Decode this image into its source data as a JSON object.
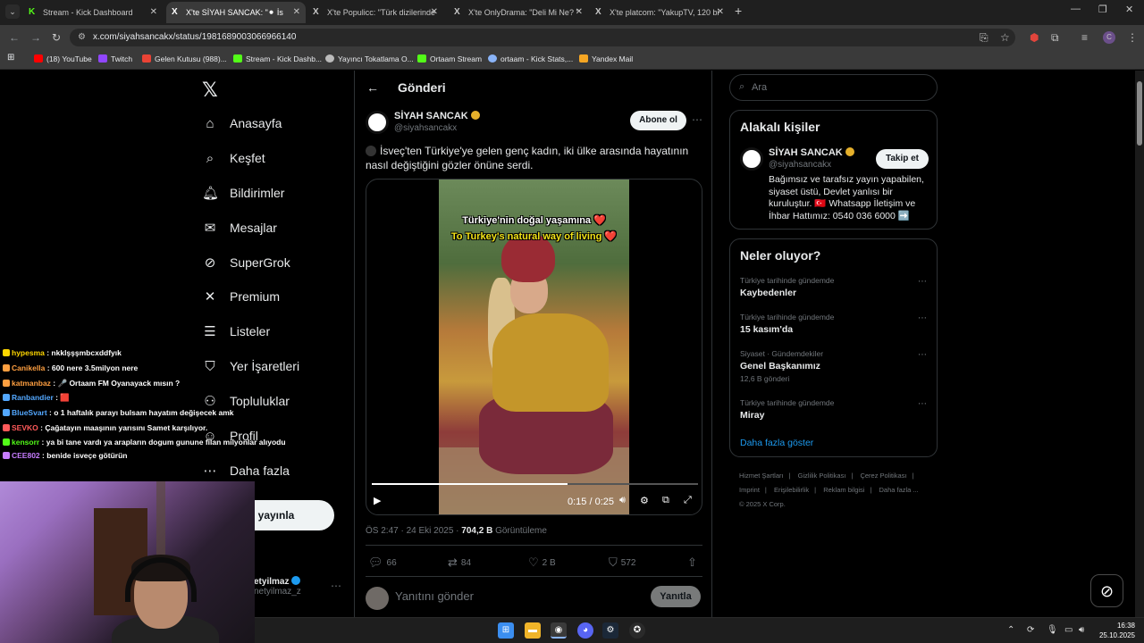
{
  "browser": {
    "tabs": [
      {
        "label": "Stream - Kick Dashboard",
        "icon": "kick-icon"
      },
      {
        "label": "X'te SİYAH SANCAK: \"⚫ İs",
        "icon": "x-icon",
        "active": true
      },
      {
        "label": "X'te Populicc: \"Türk dizilerinde",
        "icon": "x-icon"
      },
      {
        "label": "X'te OnlyDrama: \"Deli Mi Ne? \"",
        "icon": "x-icon"
      },
      {
        "label": "X'te platcom: \"YakupTV, 120 bi",
        "icon": "x-icon"
      }
    ],
    "url": "x.com/siyahsancakx/status/1981689003066966140",
    "bookmarks": [
      {
        "label": "(18) YouTube",
        "color": "#ff0000"
      },
      {
        "label": "Twitch",
        "color": "#9146ff"
      },
      {
        "label": "Gelen Kutusu (988)...",
        "color": "#ea4335"
      },
      {
        "label": "Stream - Kick Dashb...",
        "color": "#53fc18"
      },
      {
        "label": "Yayıncı Tokatlama O...",
        "color": "#bbbbbb"
      },
      {
        "label": "Ortaam Stream",
        "color": "#53fc18"
      },
      {
        "label": "ortaam - Kick Stats,...",
        "color": "#8ab4f8"
      },
      {
        "label": "Yandex Mail",
        "color": "#f5a623"
      }
    ]
  },
  "sidebar": {
    "items": [
      {
        "label": "Anasayfa",
        "icon": "home-icon"
      },
      {
        "label": "Keşfet",
        "icon": "search-icon"
      },
      {
        "label": "Bildirimler",
        "icon": "bell-icon"
      },
      {
        "label": "Mesajlar",
        "icon": "mail-icon"
      },
      {
        "label": "SuperGrok",
        "icon": "grok-icon"
      },
      {
        "label": "Premium",
        "icon": "x-icon"
      },
      {
        "label": "Listeler",
        "icon": "list-icon"
      },
      {
        "label": "Yer İşaretleri",
        "icon": "bookmark-icon"
      },
      {
        "label": "Topluluklar",
        "icon": "communities-icon"
      },
      {
        "label": "Profil",
        "icon": "profile-icon"
      },
      {
        "label": "Daha fazla",
        "icon": "more-icon"
      }
    ],
    "post_button": "eri yayınla",
    "account_name": "etyilmaz",
    "account_handle": "netyilmaz_z"
  },
  "post": {
    "header_title": "Gönderi",
    "author_name": "SİYAH SANCAK",
    "author_handle": "@siyahsancakx",
    "follow_label": "Abone ol",
    "text": "İsveç'ten Türkiye'ye gelen genç kadın, iki ülke arasında hayatının nasıl değiştiğini gözler önüne serdi.",
    "video_caption_tr": "Türkiye'nin doğal yaşamına ❤️",
    "video_caption_en": "To Turkey's natural way of living ❤️",
    "video_time": "0:15 / 0:25",
    "video_progress": 0.6,
    "timestamp": "ÖS 2:47 · 24 Eki 2025 · ",
    "views": "704,2 B",
    "views_label": " Görüntüleme",
    "replies": "66",
    "reposts": "84",
    "likes": "2 B",
    "bookmarks": "572",
    "reply_placeholder": "Yanıtını gönder",
    "reply_button": "Yanıtla"
  },
  "right": {
    "search_placeholder": "Ara",
    "related_title": "Alakalı kişiler",
    "related_name": "SİYAH SANCAK",
    "related_handle": "@siyahsancakx",
    "related_follow": "Takip et",
    "related_bio": "Bağımsız ve tarafsız yayın yapabilen, siyaset üstü, Devlet yanlısı bir kuruluştur. 🇹🇷 Whatsapp İletişim ve İhbar Hattımız: 0540 036 6000 ➡️",
    "trends_title": "Neler oluyor?",
    "trends": [
      {
        "context": "Türkiye tarihinde gündemde",
        "name": "Kaybedenler",
        "count": ""
      },
      {
        "context": "Türkiye tarihinde gündemde",
        "name": "15 kasım'da",
        "count": ""
      },
      {
        "context": "Siyaset · Gündemdekiler",
        "name": "Genel Başkanımız",
        "count": "12,6 B gönderi"
      },
      {
        "context": "Türkiye tarihinde gündemde",
        "name": "Miray",
        "count": ""
      }
    ],
    "show_more": "Daha fazla göster",
    "footer_links": [
      "Hizmet Şartları",
      "|",
      "Gizlilik Politikası",
      "|",
      "Çerez Politikası",
      "|",
      "Imprint",
      "|",
      "Erişilebilirlik",
      "|",
      "Reklam bilgisi",
      "|",
      "Daha fazla ...",
      "© 2025 X Corp."
    ]
  },
  "chat": [
    {
      "user": "hypesma",
      "color": "#ffd700",
      "text": "nkklşşşmbcxddfyık"
    },
    {
      "user": "Canikella",
      "color": "#ff9f40",
      "text": "600 nere 3.5milyon nere"
    },
    {
      "user": "katmanbaz",
      "color": "#ff9f40",
      "text": "🎤 Ortaam FM Oyanayack mısın ?"
    },
    {
      "user": "Ranbandier",
      "color": "#53a8ff",
      "text": "🟥"
    },
    {
      "user": "BlueSvart",
      "color": "#53a8ff",
      "text": "o 1 haftalık parayı bulsam hayatım değişecek amk"
    },
    {
      "user": "SEVKO",
      "color": "#ff5a5a",
      "text": "Çağatayın maaşının yarısını Samet karşılıyor."
    },
    {
      "user": "kensorr",
      "color": "#53fc18",
      "text": "ya bi tane vardı ya arapların dogum gunune filan milyonlar alıyodu"
    },
    {
      "user": "CEE802",
      "color": "#c77dff",
      "text": "benide isveçe götürün"
    }
  ],
  "system": {
    "time": "16:38",
    "date": "25.10.2025"
  }
}
